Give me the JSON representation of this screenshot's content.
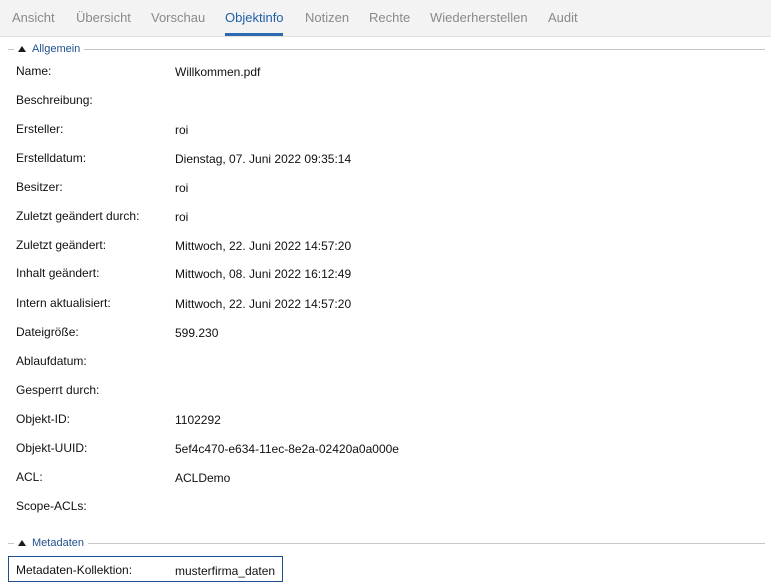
{
  "tabs": [
    {
      "label": "Ansicht"
    },
    {
      "label": "Übersicht"
    },
    {
      "label": "Vorschau"
    },
    {
      "label": "Objektinfo"
    },
    {
      "label": "Notizen"
    },
    {
      "label": "Rechte"
    },
    {
      "label": "Wiederherstellen"
    },
    {
      "label": "Audit"
    }
  ],
  "active_tab": "Objektinfo",
  "general": {
    "legend": "Allgemein",
    "fields": [
      {
        "label": "Name:",
        "value": "Willkommen.pdf"
      },
      {
        "label": "Beschreibung:",
        "value": ""
      },
      {
        "label": "Ersteller:",
        "value": "roi"
      },
      {
        "label": "Erstelldatum:",
        "value": "Dienstag, 07. Juni 2022 09:35:14"
      },
      {
        "label": "Besitzer:",
        "value": "roi"
      },
      {
        "label": "Zuletzt geändert durch:",
        "value": "roi"
      },
      {
        "label": "Zuletzt geändert:",
        "value": "Mittwoch, 22. Juni 2022 14:57:20"
      },
      {
        "label": "Inhalt geändert:",
        "value": "Mittwoch, 08. Juni 2022 16:12:49"
      },
      {
        "label": "Intern aktualisiert:",
        "value": "Mittwoch, 22. Juni 2022 14:57:20"
      },
      {
        "label": "Dateigröße:",
        "value": "599.230"
      },
      {
        "label": "Ablaufdatum:",
        "value": ""
      },
      {
        "label": "Gesperrt durch:",
        "value": ""
      },
      {
        "label": "Objekt-ID:",
        "value": "1102292"
      },
      {
        "label": "Objekt-UUID:",
        "value": "5ef4c470-e634-11ec-8e2a-02420a0a000e"
      },
      {
        "label": "ACL:",
        "value": "ACLDemo"
      },
      {
        "label": "Scope-ACLs:",
        "value": ""
      }
    ]
  },
  "metadata": {
    "legend": "Metadaten",
    "collection_label": "Metadaten-Kollektion:",
    "collection_value": "musterfirma_daten"
  },
  "colors": {
    "accent": "#1f5fa8",
    "tab_inactive": "#8a8a8a",
    "tabbar_bg": "#f3f3f3"
  },
  "icons": {
    "collapse": "caret-up-icon"
  }
}
